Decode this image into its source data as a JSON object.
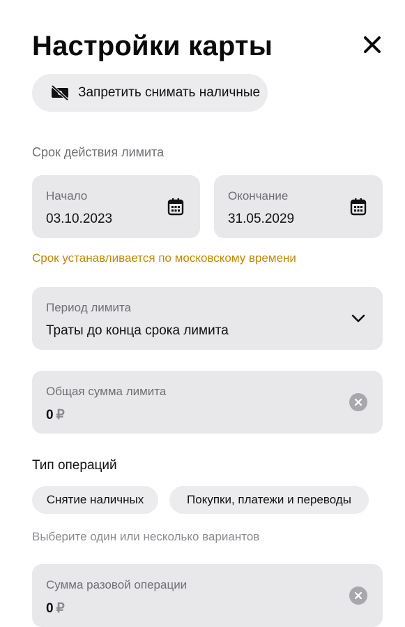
{
  "header": {
    "title": "Настройки карты"
  },
  "cash_toggle": {
    "label": "Запретить снимать наличные",
    "icon": "no-cash-icon"
  },
  "limit_period": {
    "section_label": "Срок действия лимита"
  },
  "start_date": {
    "label": "Начало",
    "value": "03.10.2023",
    "icon": "calendar-icon"
  },
  "end_date": {
    "label": "Окончание",
    "value": "31.05.2029",
    "icon": "calendar-icon"
  },
  "timezone_note": "Срок устанавливается по московскому времени",
  "period_select": {
    "label": "Период лимита",
    "value": "Траты до конца срока лимита",
    "icon": "chevron-down-icon"
  },
  "total_sum": {
    "label": "Общая сумма лимита",
    "value": "0",
    "currency": "₽"
  },
  "operation_types": {
    "title": "Тип операций",
    "options": [
      "Снятие наличных",
      "Покупки, платежи и переводы"
    ],
    "hint": "Выберите один или несколько вариантов"
  },
  "single_op_sum": {
    "label": "Сумма разовой операции",
    "value": "0",
    "currency": "₽"
  },
  "colors": {
    "accent_warning": "#c1870a",
    "field_bg": "#e8e8ea",
    "chip_bg": "#ececee"
  }
}
